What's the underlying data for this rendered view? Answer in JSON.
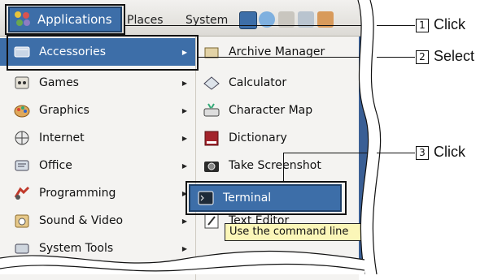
{
  "panel": {
    "applications_label": "Applications",
    "places_label": "Places",
    "system_label": "System"
  },
  "menu": {
    "items": [
      {
        "label": "Accessories",
        "icon": "accessories-icon",
        "selected": true
      },
      {
        "label": "Games",
        "icon": "games-icon"
      },
      {
        "label": "Graphics",
        "icon": "graphics-icon"
      },
      {
        "label": "Internet",
        "icon": "internet-icon"
      },
      {
        "label": "Office",
        "icon": "office-icon"
      },
      {
        "label": "Programming",
        "icon": "programming-icon"
      },
      {
        "label": "Sound & Video",
        "icon": "sound-video-icon"
      },
      {
        "label": "System Tools",
        "icon": "system-tools-icon"
      }
    ]
  },
  "submenu": {
    "items": [
      {
        "label": "Archive Manager",
        "icon": "archive-manager-icon"
      },
      {
        "label": "Calculator",
        "icon": "calculator-icon"
      },
      {
        "label": "Character Map",
        "icon": "character-map-icon"
      },
      {
        "label": "Dictionary",
        "icon": "dictionary-icon"
      },
      {
        "label": "Take Screenshot",
        "icon": "camera-icon"
      },
      {
        "label": "Terminal",
        "icon": "terminal-icon",
        "selected": true
      },
      {
        "label": "Text Editor",
        "icon": "text-editor-icon"
      }
    ]
  },
  "tooltip": {
    "text": "Use the command line"
  },
  "callouts": [
    {
      "number": "1",
      "text": "Click"
    },
    {
      "number": "2",
      "text": "Select"
    },
    {
      "number": "3",
      "text": "Click"
    }
  ],
  "colors": {
    "selection": "#3d6ea8",
    "menu_bg": "#f4f3f1",
    "desktop": "#3a5f95",
    "tooltip": "#fbf6b8"
  }
}
